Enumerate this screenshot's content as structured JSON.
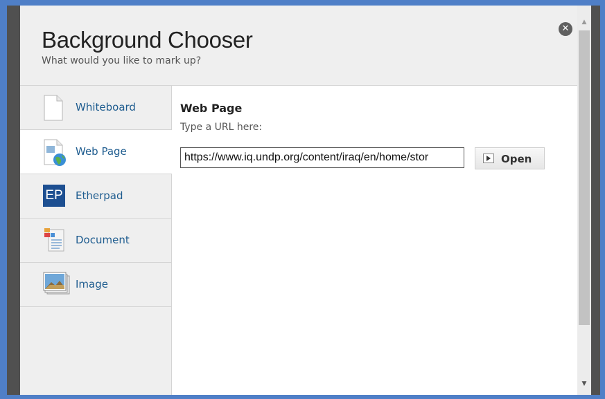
{
  "dialog": {
    "title": "Background Chooser",
    "subtitle": "What would you like to mark up?",
    "close_icon": "close-circle-icon"
  },
  "sidebar": {
    "items": [
      {
        "label": "Whiteboard",
        "icon": "blank-page-icon",
        "active": false
      },
      {
        "label": "Web Page",
        "icon": "web-page-globe-icon",
        "active": true
      },
      {
        "label": "Etherpad",
        "icon": "etherpad-icon",
        "active": false,
        "icon_text": "EP"
      },
      {
        "label": "Document",
        "icon": "document-icon",
        "active": false
      },
      {
        "label": "Image",
        "icon": "image-icon",
        "active": false
      }
    ]
  },
  "content": {
    "title": "Web Page",
    "url_label": "Type a URL here:",
    "url_value": "https://www.iq.undp.org/content/iraq/en/home/stor",
    "open_label": "Open",
    "open_icon": "play-icon"
  },
  "colors": {
    "accent_link": "#1e5c8f",
    "etherpad_bg": "#1d4f91",
    "header_bg": "#efefef",
    "outer_bg": "#4f7fc7"
  }
}
